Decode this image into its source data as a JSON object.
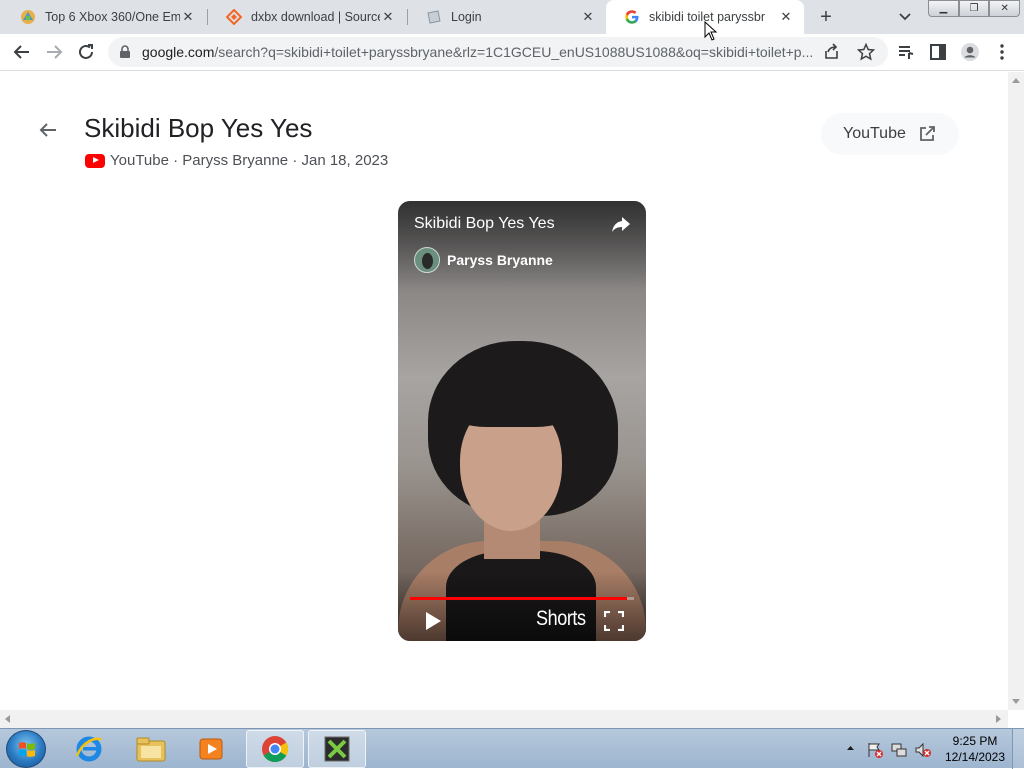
{
  "browser": {
    "tabs": [
      {
        "title": "Top 6 Xbox 360/One Emu",
        "favicon": "emulator-favicon",
        "active": false
      },
      {
        "title": "dxbx download | SourceF",
        "favicon": "sourceforge-favicon",
        "active": false
      },
      {
        "title": "Login",
        "favicon": "page-favicon",
        "active": false
      },
      {
        "title": "skibidi toilet paryssbr",
        "favicon": "google-favicon",
        "active": true
      }
    ],
    "url_host": "google.com",
    "url_rest": "/search?q=skibidi+toilet+paryssbryane&rlz=1C1GCEU_enUS1088US1088&oq=skibidi+toilet+p..."
  },
  "video_page": {
    "title": "Skibidi Bop Yes Yes",
    "meta": "YouTube · Paryss Bryanne · Jan 18, 2023",
    "open_button_label": "YouTube",
    "player": {
      "title": "Skibidi Bop Yes Yes",
      "channel": "Paryss Bryanne",
      "shorts_label": "Shorts",
      "progress": 0.97
    }
  },
  "taskbar": {
    "clock_time": "9:25 PM",
    "clock_date": "12/14/2023",
    "pinned": [
      "internet-explorer-icon",
      "file-explorer-icon",
      "media-player-icon",
      "chrome-icon",
      "xbox-emulator-icon"
    ]
  },
  "colors": {
    "youtube_red": "#ff0000",
    "tabstrip": "#dee1e6",
    "text_primary": "#202124"
  }
}
